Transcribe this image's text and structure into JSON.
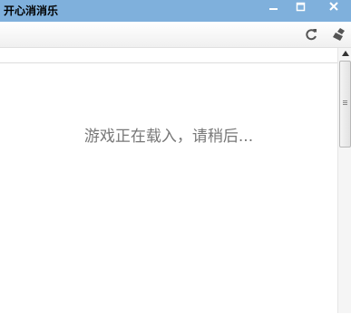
{
  "window": {
    "title": "开心消消乐",
    "controls": [
      "minimize-icon",
      "maximize-icon",
      "close-icon"
    ]
  },
  "toolbar": {
    "icons": [
      "refresh-icon",
      "clear-cache-icon"
    ]
  },
  "content": {
    "loading_text": "游戏正在载入，请稍后..."
  },
  "colors": {
    "titlebar": "#7fb0dc",
    "loading_text": "#777777"
  }
}
